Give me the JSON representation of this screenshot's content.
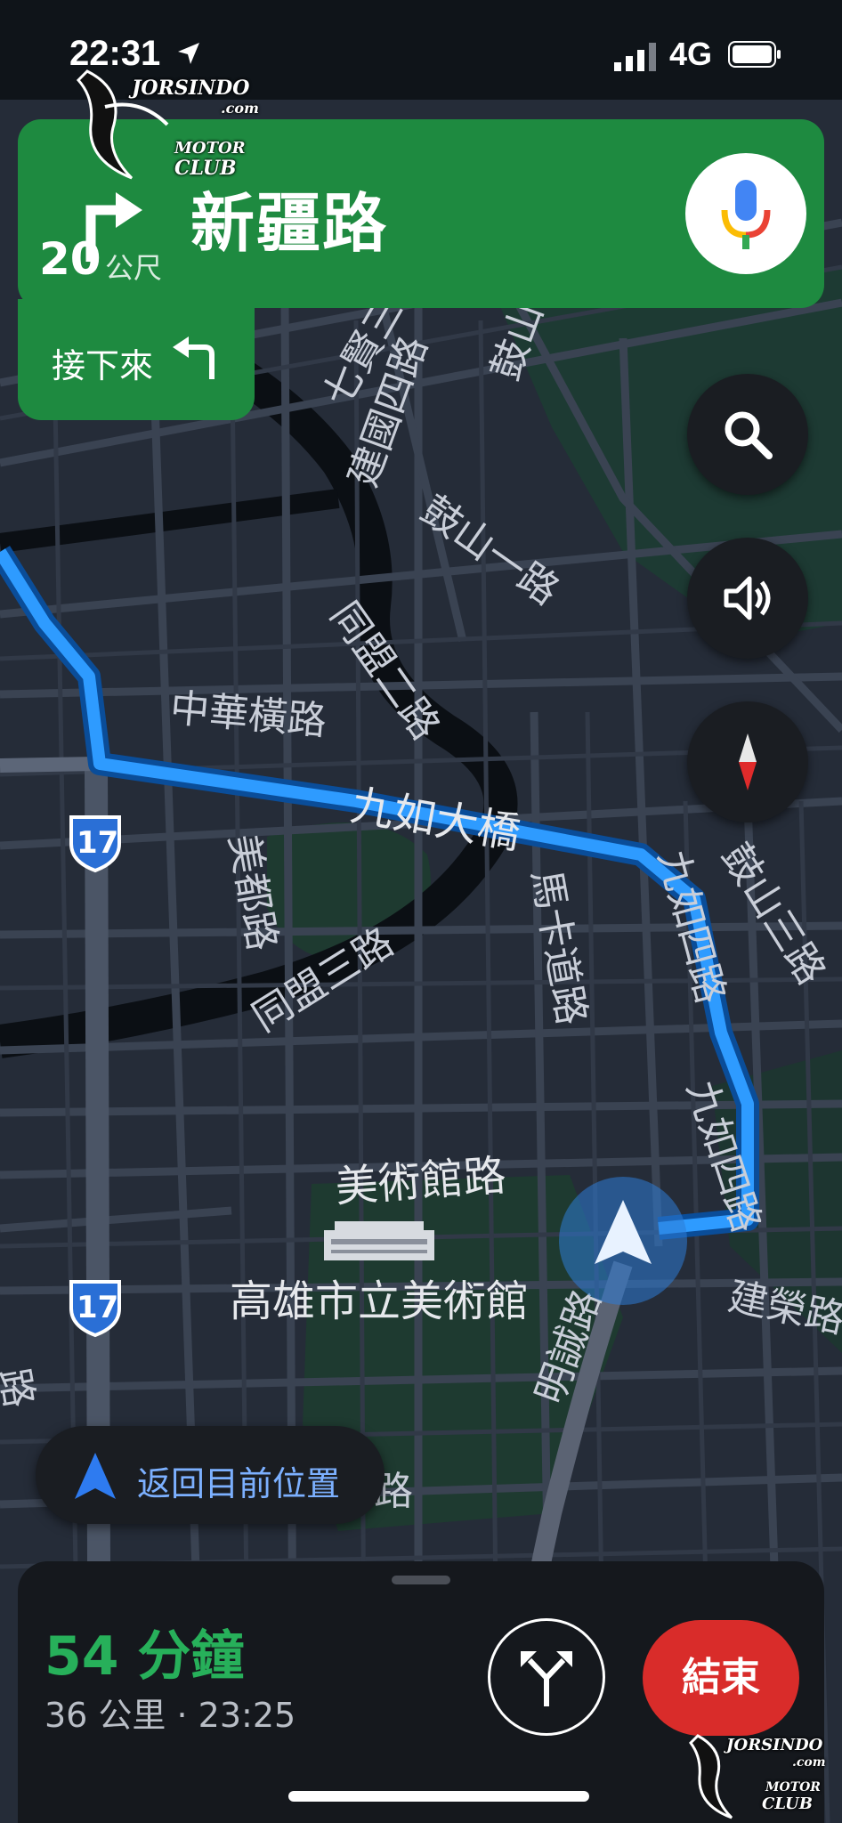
{
  "status_bar": {
    "time": "22:31",
    "network": "4G",
    "icons": [
      "location-arrow-icon",
      "signal-icon",
      "battery-icon"
    ]
  },
  "navigation": {
    "distance_value": "20",
    "distance_unit": "公尺",
    "street": "新疆路",
    "next_label": "接下來",
    "turn_icon": "turn-left-arrow-icon",
    "next_icon": "sharp-left-arrow-icon"
  },
  "map": {
    "labels": {
      "qixian": "七賢三路",
      "jianguo": "建國四路",
      "gushan_top": "鼓山二路",
      "gushan1": "鼓山一路",
      "tongmeng_top": "同盟二路",
      "zhonghua": "中華橫路",
      "jiuru_bridge": "九如大橋",
      "meidu": "美都路",
      "tongmeng_bottom": "同盟三路",
      "makadao": "馬卡道路",
      "jiuru4_top": "九如四路",
      "gushan3": "鼓山三路",
      "jiuru4_bottom": "九如四路",
      "meishuguan_rd": "美術館路",
      "museum": "高雄市立美術館",
      "jianrong": "建榮路",
      "roadlabel_lower": "路",
      "mingcheng": "明誠路",
      "left_edge": "路"
    },
    "highway_shield": "17",
    "colors": {
      "route": "#1e90ff",
      "route_glow": "#5ab4ff",
      "park": "#1e3a30"
    }
  },
  "controls": {
    "search_icon": "search-icon",
    "sound_icon": "speaker-icon",
    "compass_icon": "compass-icon",
    "mic_icon": "microphone-icon"
  },
  "recenter": {
    "label": "返回目前位置"
  },
  "trip": {
    "eta_minutes": "54 分鐘",
    "distance_and_arrival": "36 公里 · 23:25",
    "end_label": "結束",
    "alt_routes_icon": "route-options-icon"
  },
  "watermark": {
    "brand": "JORSINDO",
    "domain": ".com",
    "club_top": "MOTOR",
    "club_bottom": "CLUB"
  },
  "colors": {
    "banner_green": "#1e8a40",
    "eta_green": "#27b05a",
    "end_red": "#d92c2a",
    "recenter_blue": "#7cb0ff"
  }
}
